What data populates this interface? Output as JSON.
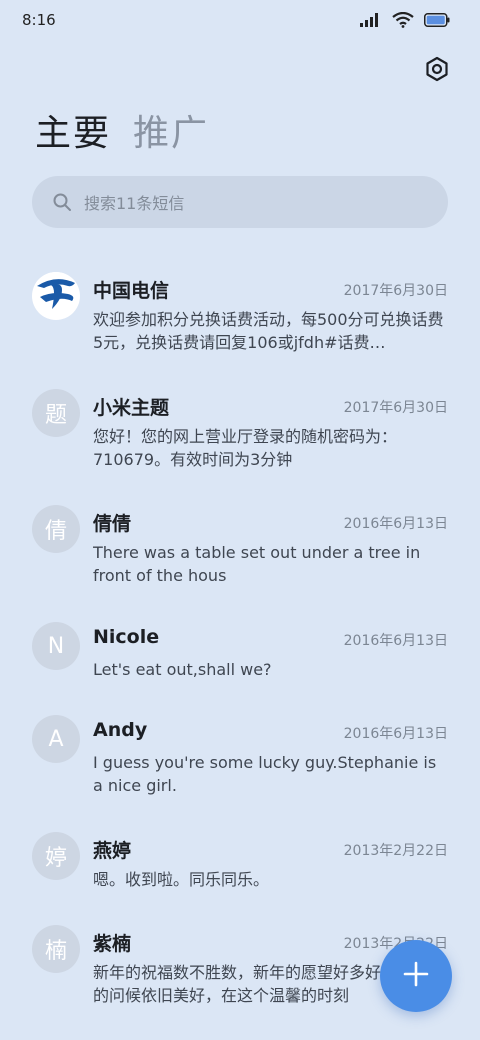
{
  "status_bar": {
    "time": "8:16"
  },
  "header": {
    "settings_icon": "hexagon-settings-icon",
    "tabs": [
      {
        "label": "主要",
        "active": true
      },
      {
        "label": "推广",
        "active": false
      }
    ]
  },
  "search": {
    "placeholder": "搜索11条短信"
  },
  "messages": [
    {
      "avatar_type": "logo",
      "avatar_text": "",
      "sender": "中国电信",
      "date": "2017年6月30日",
      "preview": "欢迎参加积分兑换话费活动，每500分可兑换话费5元，兑换话费请回复106或jfdh#话费…"
    },
    {
      "avatar_type": "letter",
      "avatar_text": "题",
      "sender": "小米主题",
      "date": "2017年6月30日",
      "preview": "您好！您的网上营业厅登录的随机密码为：710679。有效时间为3分钟"
    },
    {
      "avatar_type": "letter",
      "avatar_text": "倩",
      "sender": "倩倩",
      "date": "2016年6月13日",
      "preview": "There was a table set out under a tree in front of the hous"
    },
    {
      "avatar_type": "letter",
      "avatar_text": "N",
      "sender": "Nicole",
      "date": "2016年6月13日",
      "preview": "Let's eat out,shall we?"
    },
    {
      "avatar_type": "letter",
      "avatar_text": "A",
      "sender": "Andy",
      "date": "2016年6月13日",
      "preview": "I guess you're some lucky guy.Stephanie is a nice girl."
    },
    {
      "avatar_type": "letter",
      "avatar_text": "婷",
      "sender": "燕婷",
      "date": "2013年2月22日",
      "preview": "嗯。收到啦。同乐同乐。"
    },
    {
      "avatar_type": "letter",
      "avatar_text": "楠",
      "sender": "紫楠",
      "date": "2013年2月22日",
      "preview": "新年的祝福数不胜数，新年的愿望好多好多，新年的问候依旧美好，在这个温馨的时刻"
    }
  ],
  "fab": {
    "icon": "plus-icon",
    "color": "#4a8de6"
  }
}
